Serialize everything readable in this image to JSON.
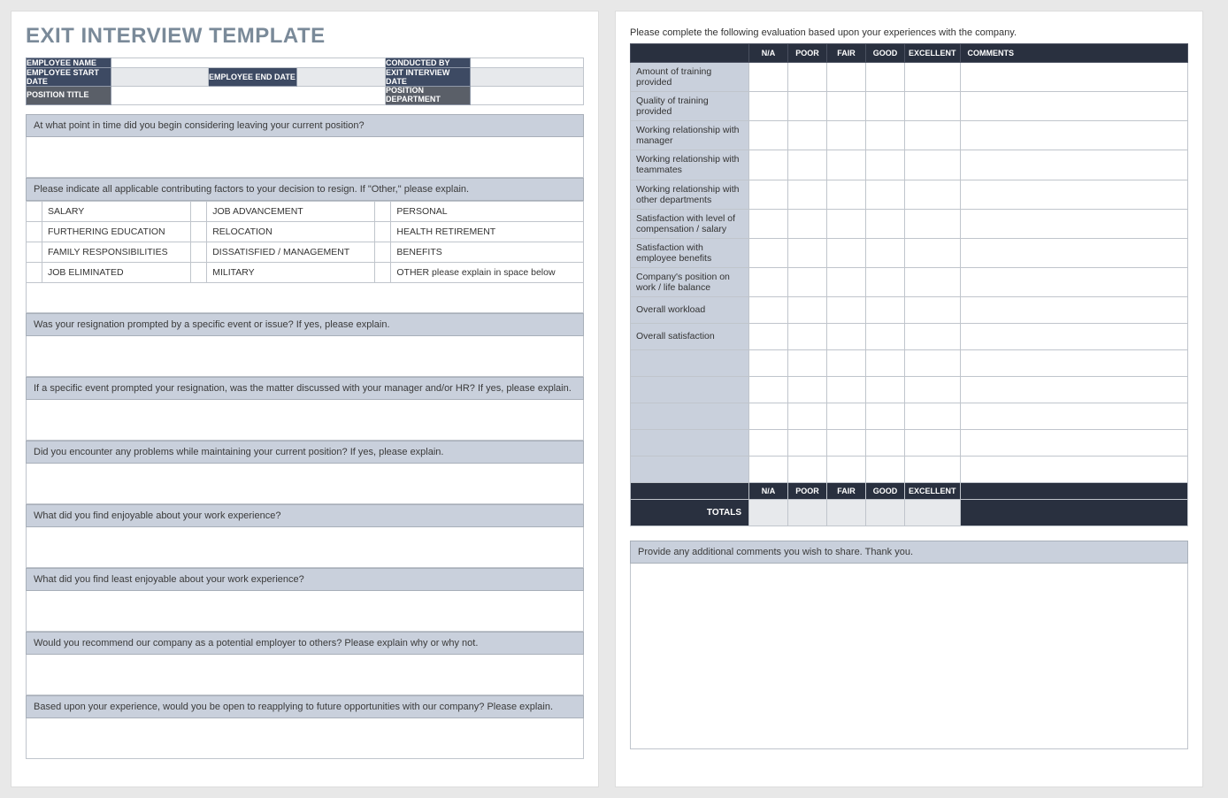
{
  "title": "EXIT INTERVIEW TEMPLATE",
  "header": {
    "employee_name_label": "EMPLOYEE NAME",
    "conducted_by_label": "CONDUCTED BY",
    "start_date_label": "EMPLOYEE START DATE",
    "end_date_label": "EMPLOYEE END DATE",
    "interview_date_label": "EXIT INTERVIEW DATE",
    "position_title_label": "POSITION TITLE",
    "position_dept_label": "POSITION DEPARTMENT",
    "employee_name": "",
    "conducted_by": "",
    "start_date": "",
    "end_date": "",
    "interview_date": "",
    "position_title": "",
    "position_dept": ""
  },
  "questions": {
    "q1": "At what point in time did you begin considering leaving your current position?",
    "q2": "Please indicate all applicable contributing factors to your decision to resign. If \"Other,\" please explain.",
    "q3": "Was your resignation prompted by a specific event or issue? If yes, please explain.",
    "q4": "If a specific event prompted your resignation, was the matter discussed with your manager and/or HR? If yes, please explain.",
    "q5": "Did you encounter any problems while maintaining your current position?  If yes, please explain.",
    "q6": "What did you find enjoyable about your work experience?",
    "q7": "What did you find least enjoyable about your work experience?",
    "q8": "Would you recommend our company as a potential employer to others? Please explain why or why not.",
    "q9": "Based upon your experience, would you be open to reapplying to future opportunities with our company?  Please explain."
  },
  "factors": [
    [
      "SALARY",
      "JOB ADVANCEMENT",
      "PERSONAL"
    ],
    [
      "FURTHERING EDUCATION",
      "RELOCATION",
      "HEALTH RETIREMENT"
    ],
    [
      "FAMILY RESPONSIBILITIES",
      "DISSATISFIED / MANAGEMENT",
      "BENEFITS"
    ],
    [
      "JOB ELIMINATED",
      "MILITARY",
      "OTHER please explain in space below"
    ]
  ],
  "eval": {
    "intro": "Please complete the following evaluation based upon your experiences with the company.",
    "cols": [
      "N/A",
      "POOR",
      "FAIR",
      "GOOD",
      "EXCELLENT",
      "COMMENTS"
    ],
    "rows": [
      "Amount of training provided",
      "Quality of training provided",
      "Working relationship with manager",
      "Working relationship with teammates",
      "Working relationship with other departments",
      "Satisfaction with level of compensation / salary",
      "Satisfaction with employee benefits",
      "Company's position on work / life balance",
      "Overall workload",
      "Overall satisfaction",
      "",
      "",
      "",
      "",
      ""
    ],
    "totals_label": "TOTALS"
  },
  "additional": {
    "prompt": "Provide any additional comments you wish to share.  Thank you."
  }
}
